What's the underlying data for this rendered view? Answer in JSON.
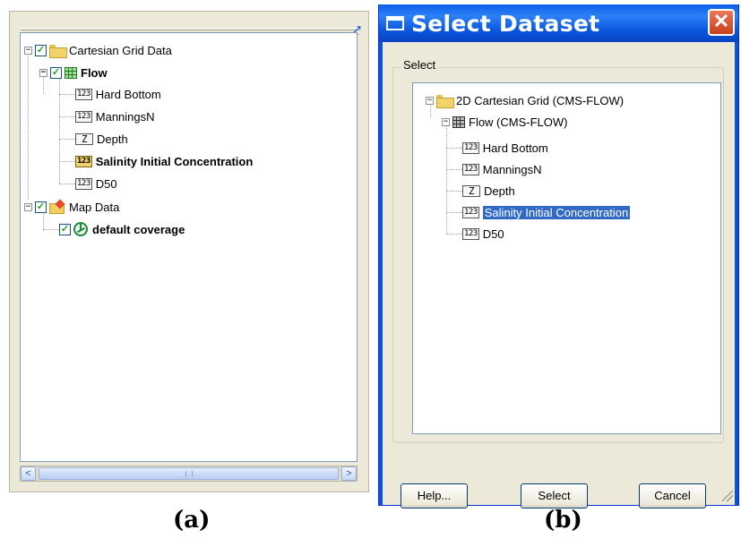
{
  "panel_a": {
    "caption": "(a)",
    "tree": [
      {
        "label": "Cartesian Grid Data",
        "bold": false
      },
      {
        "label": "Flow",
        "bold": true
      },
      {
        "label": "Hard Bottom",
        "badge": "123"
      },
      {
        "label": "ManningsN",
        "badge": "123"
      },
      {
        "label": "Depth",
        "badge": "Z"
      },
      {
        "label": "Salinity Initial Concentration",
        "badge": "123",
        "bold": true
      },
      {
        "label": "D50",
        "badge": "123"
      },
      {
        "label": "Map Data",
        "bold": false
      },
      {
        "label": "default coverage",
        "bold": true
      }
    ]
  },
  "dialog": {
    "title": "Select Dataset",
    "close_glyph": "✕",
    "group_label": "Select",
    "tree": [
      {
        "label": "2D Cartesian Grid (CMS-FLOW)"
      },
      {
        "label": "Flow (CMS-FLOW)"
      },
      {
        "label": "Hard Bottom",
        "badge": "123"
      },
      {
        "label": "ManningsN",
        "badge": "123"
      },
      {
        "label": "Depth",
        "badge": "Z"
      },
      {
        "label": "Salinity Initial Concentration",
        "badge": "123",
        "selected": true
      },
      {
        "label": "D50",
        "badge": "123"
      }
    ],
    "buttons": {
      "help": "Help...",
      "select": "Select",
      "cancel": "Cancel"
    },
    "caption": "(b)"
  },
  "glyphs": {
    "expanded": "−",
    "check": "✓",
    "pin": "➚",
    "scroll_left": "<",
    "scroll_right": ">"
  },
  "colors": {
    "titlebar": "#0a5fe6",
    "selection": "#316ac5",
    "check_green": "#21a121"
  }
}
